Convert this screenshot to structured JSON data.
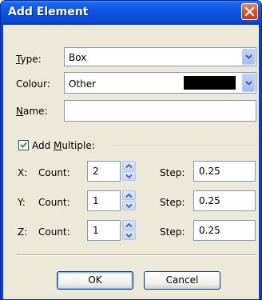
{
  "window": {
    "title": "Add Element"
  },
  "form": {
    "type_label_u": "T",
    "type_label_rest": "ype:",
    "type_value": "Box",
    "colour_label": "Colour:",
    "colour_value": "Other",
    "colour_swatch": "#000000",
    "name_label_u": "N",
    "name_label_rest": "ame:",
    "name_value": ""
  },
  "multiple": {
    "checkbox_label_pre": "Add ",
    "checkbox_label_u": "M",
    "checkbox_label_post": "ultiple:",
    "checked": true,
    "rows": [
      {
        "axis": "X:",
        "count_label": "Count:",
        "count": "2",
        "step_label": "Step:",
        "step": "0.25"
      },
      {
        "axis": "Y:",
        "count_label": "Count:",
        "count": "1",
        "step_label": "Step:",
        "step": "0.25"
      },
      {
        "axis": "Z:",
        "count_label": "Count:",
        "count": "1",
        "step_label": "Step:",
        "step": "0.25"
      }
    ]
  },
  "buttons": {
    "ok": "OK",
    "cancel": "Cancel"
  }
}
